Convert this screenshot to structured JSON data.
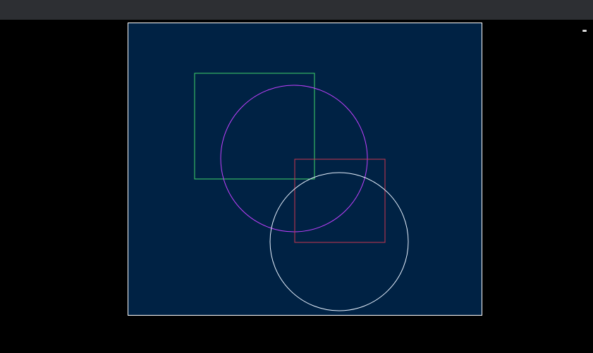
{
  "window": {
    "minimize_glyph": "-"
  },
  "canvas": {
    "background": "#002244",
    "border_color": "#ffffff"
  },
  "shapes": [
    {
      "kind": "rectangle",
      "name": "green-rectangle",
      "stroke": "#3fd46a"
    },
    {
      "kind": "circle",
      "name": "purple-circle",
      "stroke": "#c040ff"
    },
    {
      "kind": "rectangle",
      "name": "red-rectangle",
      "stroke": "#c8364f"
    },
    {
      "kind": "circle",
      "name": "white-circle",
      "stroke": "#e8f2ff"
    }
  ]
}
